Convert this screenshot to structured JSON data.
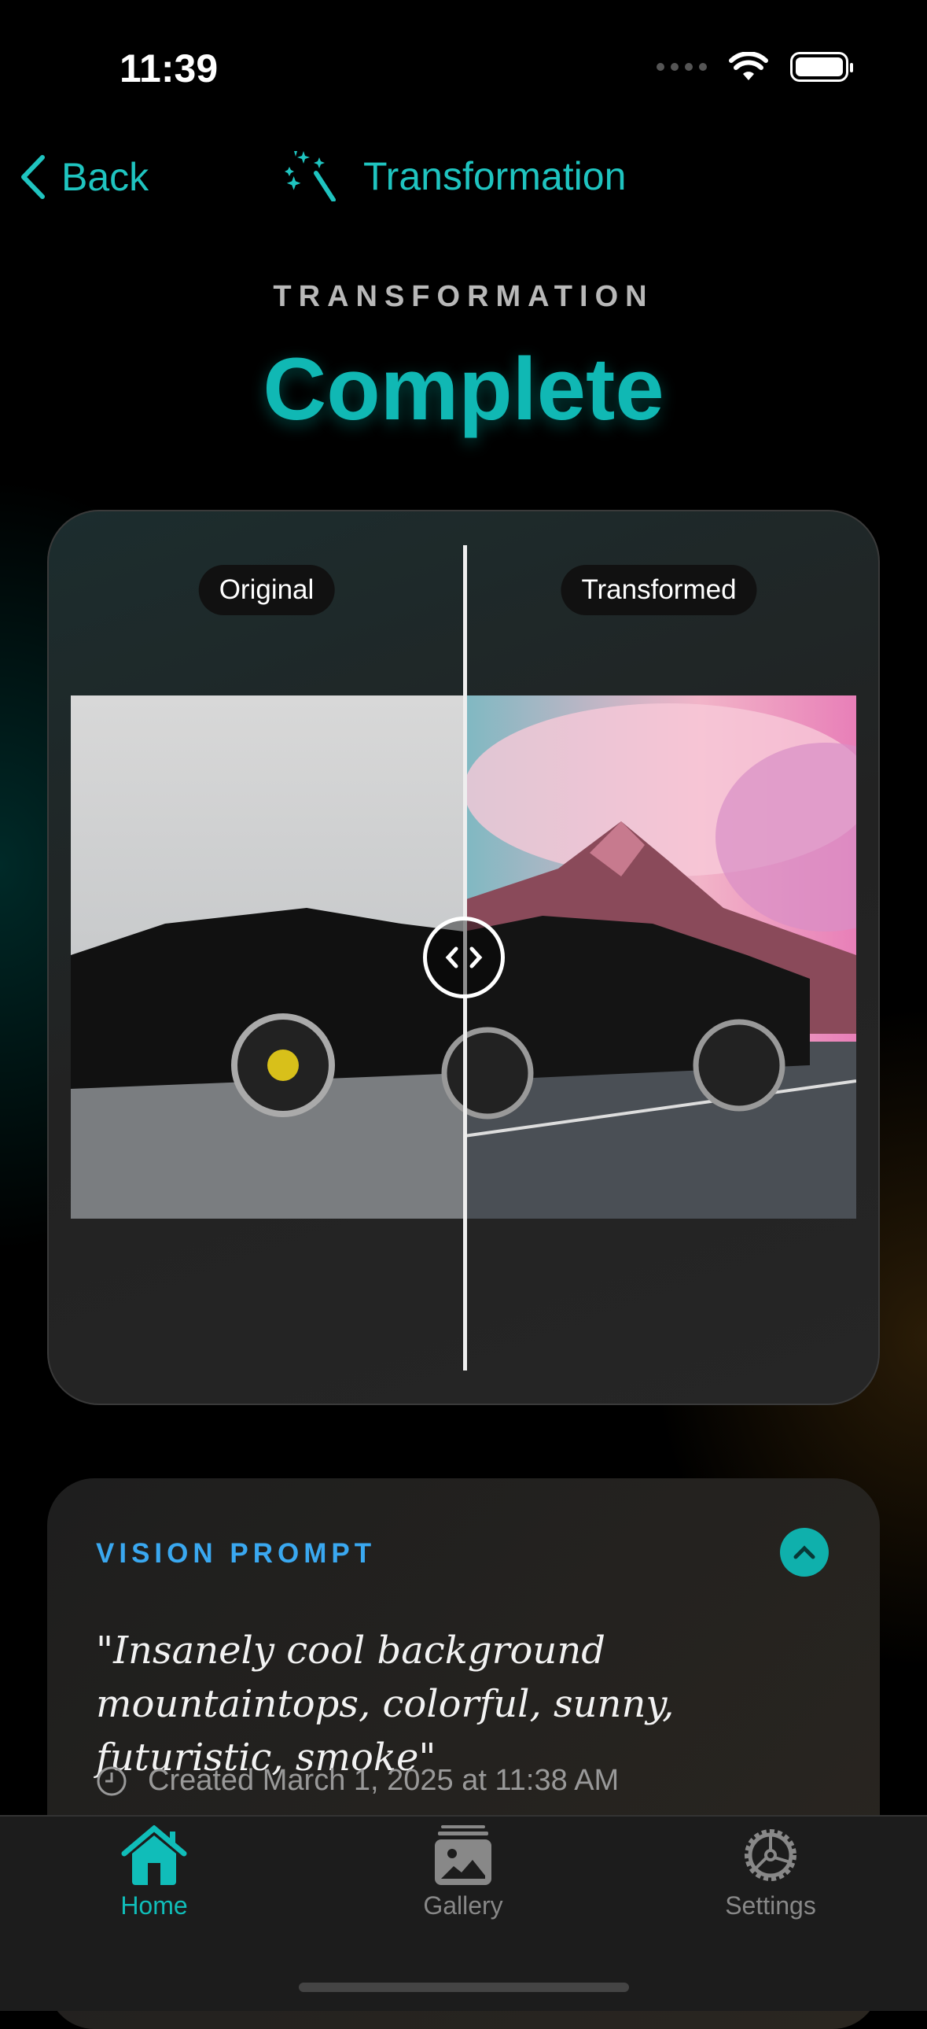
{
  "status_bar": {
    "time": "11:39"
  },
  "nav": {
    "back_label": "Back",
    "title": "Transformation",
    "title_icon": "magic-wand-icon"
  },
  "header": {
    "eyebrow": "TRANSFORMATION",
    "headline": "Complete"
  },
  "comparison": {
    "original_label": "Original",
    "transformed_label": "Transformed",
    "split_percent": 50
  },
  "prompt_card": {
    "label": "VISION PROMPT",
    "quote": "\"Insanely cool background mountaintops, colorful, sunny, futuristic, smoke\"",
    "created": "Created March 1, 2025 at 11:38 AM"
  },
  "tabs": [
    {
      "label": "Home",
      "icon": "house-icon",
      "active": true
    },
    {
      "label": "Gallery",
      "icon": "photo-stack-icon"
    },
    {
      "label": "Settings",
      "icon": "gear-icon"
    }
  ],
  "colors": {
    "accent": "#10b8b4",
    "prompt_label": "#3aa8f0"
  }
}
